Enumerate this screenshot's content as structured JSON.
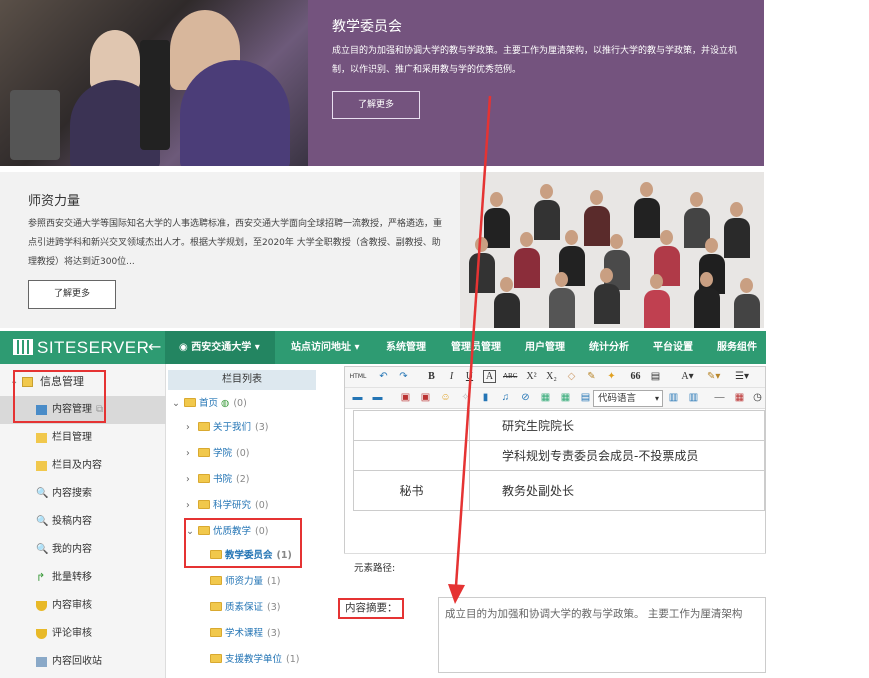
{
  "hero": {
    "title": "教学委员会",
    "description": "成立目的为加强和协调大学的教与学政策。主要工作为厘清架构，以推行大学的教与学政策，并设立机制，以作识别、推广和采用教与学的优秀范例。",
    "button": "了解更多"
  },
  "faculty": {
    "title": "师资力量",
    "description": "参照西安交通大学等国际知名大学的人事选聘标准，西安交通大学面向全球招聘一流教授，严格遴选，重点引进跨学科和新兴交叉领域杰出人才。根据大学规划，至2020年 大学全职教授（含教授、副教授、助理教授）将达到近300位...",
    "button": "了解更多"
  },
  "topbar": {
    "logo": "SITESERVER",
    "site": "西安交通大学",
    "nav": [
      "站点访问地址",
      "系统管理",
      "管理员管理",
      "用户管理",
      "统计分析",
      "平台设置",
      "服务组件"
    ]
  },
  "sidebar": {
    "group": "信息管理",
    "items": [
      "内容管理",
      "栏目管理",
      "栏目及内容",
      "内容搜索",
      "投稿内容",
      "我的内容",
      "批量转移",
      "内容审核",
      "评论审核",
      "内容回收站"
    ]
  },
  "tree": {
    "header": "栏目列表",
    "root": {
      "name": "首页",
      "count": "(0)"
    },
    "nodes": [
      {
        "name": "关于我们",
        "count": "(3)"
      },
      {
        "name": "学院",
        "count": "(0)"
      },
      {
        "name": "书院",
        "count": "(2)"
      },
      {
        "name": "科学研究",
        "count": "(0)"
      },
      {
        "name": "优质教学",
        "count": "(0)"
      }
    ],
    "children": [
      {
        "name": "教学委员会",
        "count": "(1)"
      },
      {
        "name": "师资力量",
        "count": "(1)"
      },
      {
        "name": "质素保证",
        "count": "(3)"
      },
      {
        "name": "学术课程",
        "count": "(3)"
      },
      {
        "name": "支援教学单位",
        "count": "(1)"
      }
    ]
  },
  "editor": {
    "code_lang": "代码语言",
    "rows": [
      {
        "role": "",
        "title": "研究生院院长"
      },
      {
        "role": "",
        "title": "学科规划专责委员会成员-不投票成员"
      },
      {
        "role": "秘书",
        "title": "教务处副处长"
      }
    ],
    "path_label": "元素路径:"
  },
  "summary": {
    "label": "内容摘要：",
    "value": "成立目的为加强和协调大学的教与学政策。 主要工作为厘清架构"
  },
  "colors": {
    "brand_green": "#2e9b72",
    "hero_purple": "#74537e",
    "annotation_red": "#e53333"
  }
}
